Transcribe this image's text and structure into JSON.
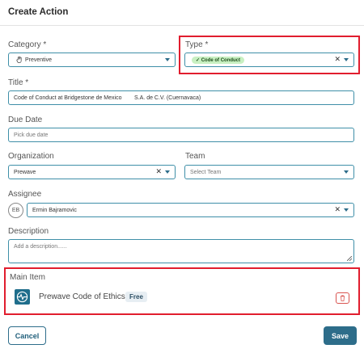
{
  "dialog": {
    "title": "Create Action"
  },
  "category": {
    "label": "Category *",
    "value": "Preventive",
    "icon": "hand-icon"
  },
  "type": {
    "label": "Type *",
    "tag": "Code of Conduct",
    "tag_color": "#c8f0c2"
  },
  "title_field": {
    "label": "Title *",
    "value": "Code of Conduct at Bridgestone de Mexico        S.A. de C.V. (Cuernavaca)"
  },
  "due_date": {
    "label": "Due Date",
    "placeholder": "Pick due date"
  },
  "organization": {
    "label": "Organization",
    "value": "Prewave"
  },
  "team": {
    "label": "Team",
    "placeholder": "Select Team"
  },
  "assignee": {
    "label": "Assignee",
    "initials": "EB",
    "value": "Ermin Bajramovic"
  },
  "description": {
    "label": "Description",
    "placeholder": "Add a description......"
  },
  "main_item": {
    "label": "Main Item",
    "name": "Prewave Code of Ethics",
    "badge": "Free",
    "icon": "heartbeat-icon"
  },
  "actions": {
    "cancel": "Cancel",
    "save": "Save"
  },
  "colors": {
    "accent": "#2d6d8a",
    "highlight": "#e11d2e",
    "danger": "#d9534f"
  }
}
